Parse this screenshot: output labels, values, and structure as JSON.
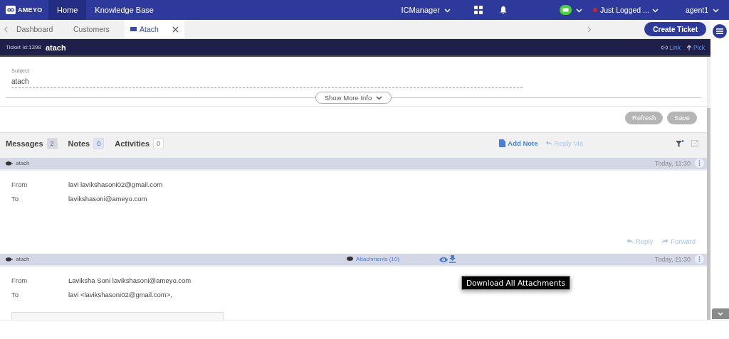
{
  "app_bar": {
    "logo": "AMEYO",
    "nav": [
      {
        "label": "Home",
        "selected": true
      },
      {
        "label": "Knowledge Base",
        "selected": false
      }
    ],
    "campaign": "ICManager",
    "status": {
      "label": "Just Logged ...",
      "color": "#c62828"
    },
    "user": "agent1"
  },
  "tabs": [
    {
      "label": "Dashboard",
      "selected": false
    },
    {
      "label": "Customers",
      "selected": false
    },
    {
      "label": "Atach",
      "selected": true
    }
  ],
  "create_button": "Create Ticket",
  "ticket": {
    "id_label": "Ticket Id:1398",
    "title": "atach",
    "actions": [
      "Link",
      "Pick"
    ]
  },
  "subject": {
    "label": "Subject",
    "value": "atach"
  },
  "show_more": "Show More Info",
  "form_buttons": [
    {
      "label": "Refresh",
      "disabled": true
    },
    {
      "label": "Save",
      "disabled": true
    }
  ],
  "activity_tabs": [
    {
      "label": "Messages",
      "count": "2",
      "color": "#d5d9e6"
    },
    {
      "label": "Notes",
      "count": "0",
      "color": "#dce3fa"
    },
    {
      "label": "Activities",
      "count": "0",
      "color": "#ffffff"
    }
  ],
  "toolbar": [
    {
      "label": "Add Note",
      "disabled": false
    },
    {
      "label": "Reply Via",
      "disabled": true
    }
  ],
  "messages": [
    {
      "subject": "atach",
      "time": "Today, 11:30",
      "fields": [
        {
          "label": "From",
          "value": "lavi lavikshasoni02@gmail.com"
        },
        {
          "label": "To",
          "value": "lavikshasoni@ameyo.com"
        }
      ],
      "actions": [
        {
          "label": "Reply",
          "disabled": true
        },
        {
          "label": "Forward",
          "disabled": true
        }
      ]
    },
    {
      "subject": "atach",
      "attachments": "Attachments (10)",
      "time": "Today, 11:30",
      "fields": [
        {
          "label": "From",
          "value": "Laviksha Soni lavikshasoni@ameyo.com"
        },
        {
          "label": "To",
          "value": "lavi <lavikshasoni02@gmail.com>,"
        }
      ]
    }
  ],
  "tooltip": "Download All Attachments"
}
